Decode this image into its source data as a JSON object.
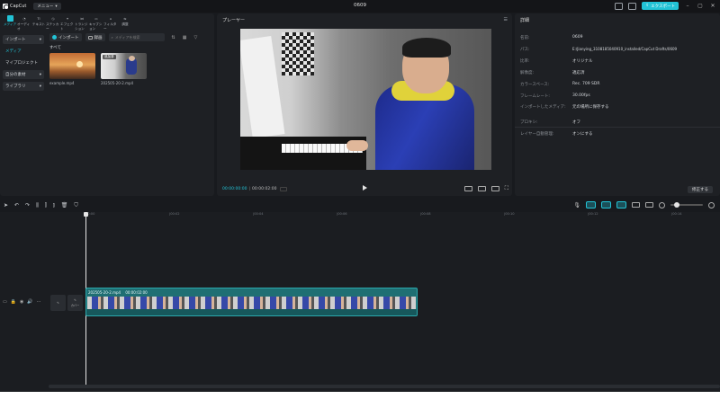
{
  "app": {
    "name": "CapCut",
    "project_title": "0609",
    "menu_label": "メニュー",
    "export_label": "エクスポート"
  },
  "tool_tabs": [
    {
      "label": "メディア",
      "icon": "media-icon"
    },
    {
      "label": "オーディオ",
      "icon": "audio-icon"
    },
    {
      "label": "テキスト",
      "icon": "text-icon"
    },
    {
      "label": "ステッカー",
      "icon": "sticker-icon"
    },
    {
      "label": "エフェクト",
      "icon": "effects-icon"
    },
    {
      "label": "トランジション",
      "icon": "transition-icon"
    },
    {
      "label": "キャプション",
      "icon": "captions-icon"
    },
    {
      "label": "フィルター",
      "icon": "filter-icon"
    },
    {
      "label": "調整",
      "icon": "adjust-icon"
    }
  ],
  "side_nav": {
    "import": "インポート",
    "media": "メディア",
    "your_projects": "マイプロジェクト",
    "my_assets": "自分の素材",
    "library": "ライブラリ"
  },
  "media": {
    "import_btn": "インポート",
    "record_btn": "録画",
    "search_placeholder": "メディアを検索",
    "all_label": "すべて",
    "items": [
      {
        "name": "example.mp4",
        "badge": ""
      },
      {
        "name": "202505-20-2.mp4",
        "badge": "追加済"
      }
    ]
  },
  "player": {
    "title": "プレーヤー",
    "current_time": "00:00:00:00",
    "duration": "00:00:02:00"
  },
  "details": {
    "title": "詳細",
    "rows": [
      {
        "key": "名前:",
        "value": "0609"
      },
      {
        "key": "パス:",
        "value": "E:/Jianying_3108185040910_installed/CapCut Drafts/0609"
      },
      {
        "key": "比率:",
        "value": "オリジナル"
      },
      {
        "key": "解像度:",
        "value": "適応済"
      },
      {
        "key": "カラースペース:",
        "value": "Rec. 709 SDR"
      },
      {
        "key": "フレームレート:",
        "value": "30.00fps"
      },
      {
        "key": "インポートしたメディア:",
        "value": "元の場所に保存する"
      }
    ],
    "settings": [
      {
        "key": "プロキシ:",
        "value": "オフ"
      },
      {
        "key": "レイヤー自動管理:",
        "value": "オンにする"
      }
    ],
    "change_btn": "修正する"
  },
  "timeline": {
    "ruler_labels": [
      "00:00",
      "|00:02",
      "|00:04",
      "|00:06",
      "|00:08",
      "|00:10",
      "|00:12",
      "|00:14",
      "|00:16",
      "|00:18",
      "|00:20",
      "|00:22"
    ],
    "cover_label": "カバー",
    "clip": {
      "name": "202505-20-2.mp4",
      "duration": "00:00:02:00"
    }
  },
  "colors": {
    "accent": "#22c3d6",
    "panel": "#1e2024",
    "background": "#181a1e",
    "clip": "#1f6f73"
  }
}
